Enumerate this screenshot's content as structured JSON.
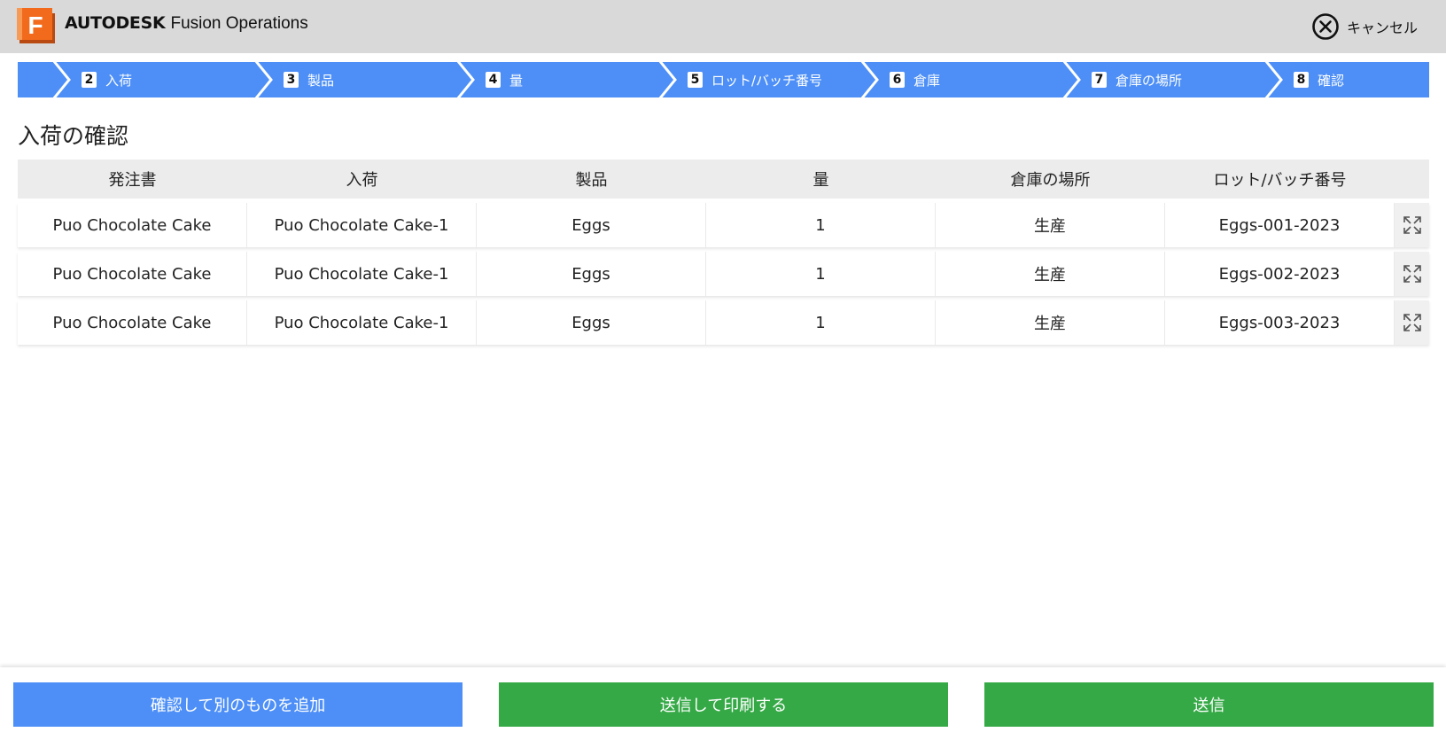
{
  "header": {
    "brand_company": "AUTODESK",
    "brand_product": "Fusion Operations",
    "logo_letter": "F",
    "cancel_label": "キャンセル",
    "colors": {
      "bar": "#d9d9d9",
      "logo": "#f26b1d"
    }
  },
  "stepper": {
    "color": "#4d8ff7",
    "steps": [
      {
        "num": "2",
        "label": "入荷"
      },
      {
        "num": "3",
        "label": "製品"
      },
      {
        "num": "4",
        "label": "量"
      },
      {
        "num": "5",
        "label": "ロット/バッチ番号"
      },
      {
        "num": "6",
        "label": "倉庫"
      },
      {
        "num": "7",
        "label": "倉庫の場所"
      },
      {
        "num": "8",
        "label": "確認"
      }
    ]
  },
  "page_title": "入荷の確認",
  "table": {
    "columns": [
      "発注書",
      "入荷",
      "製品",
      "量",
      "倉庫の場所",
      "ロット/バッチ番号"
    ],
    "rows": [
      [
        "Puo Chocolate Cake",
        "Puo Chocolate Cake-1",
        "Eggs",
        "1",
        "生産",
        "Eggs-001-2023"
      ],
      [
        "Puo Chocolate Cake",
        "Puo Chocolate Cake-1",
        "Eggs",
        "1",
        "生産",
        "Eggs-002-2023"
      ],
      [
        "Puo Chocolate Cake",
        "Puo Chocolate Cake-1",
        "Eggs",
        "1",
        "生産",
        "Eggs-003-2023"
      ]
    ],
    "row_action_icon": "expand-icon"
  },
  "footer": {
    "confirm_add_label": "確認して別のものを追加",
    "send_print_label": "送信して印刷する",
    "send_label": "送信",
    "colors": {
      "primary": "#4d8ff7",
      "success": "#36a947"
    }
  }
}
